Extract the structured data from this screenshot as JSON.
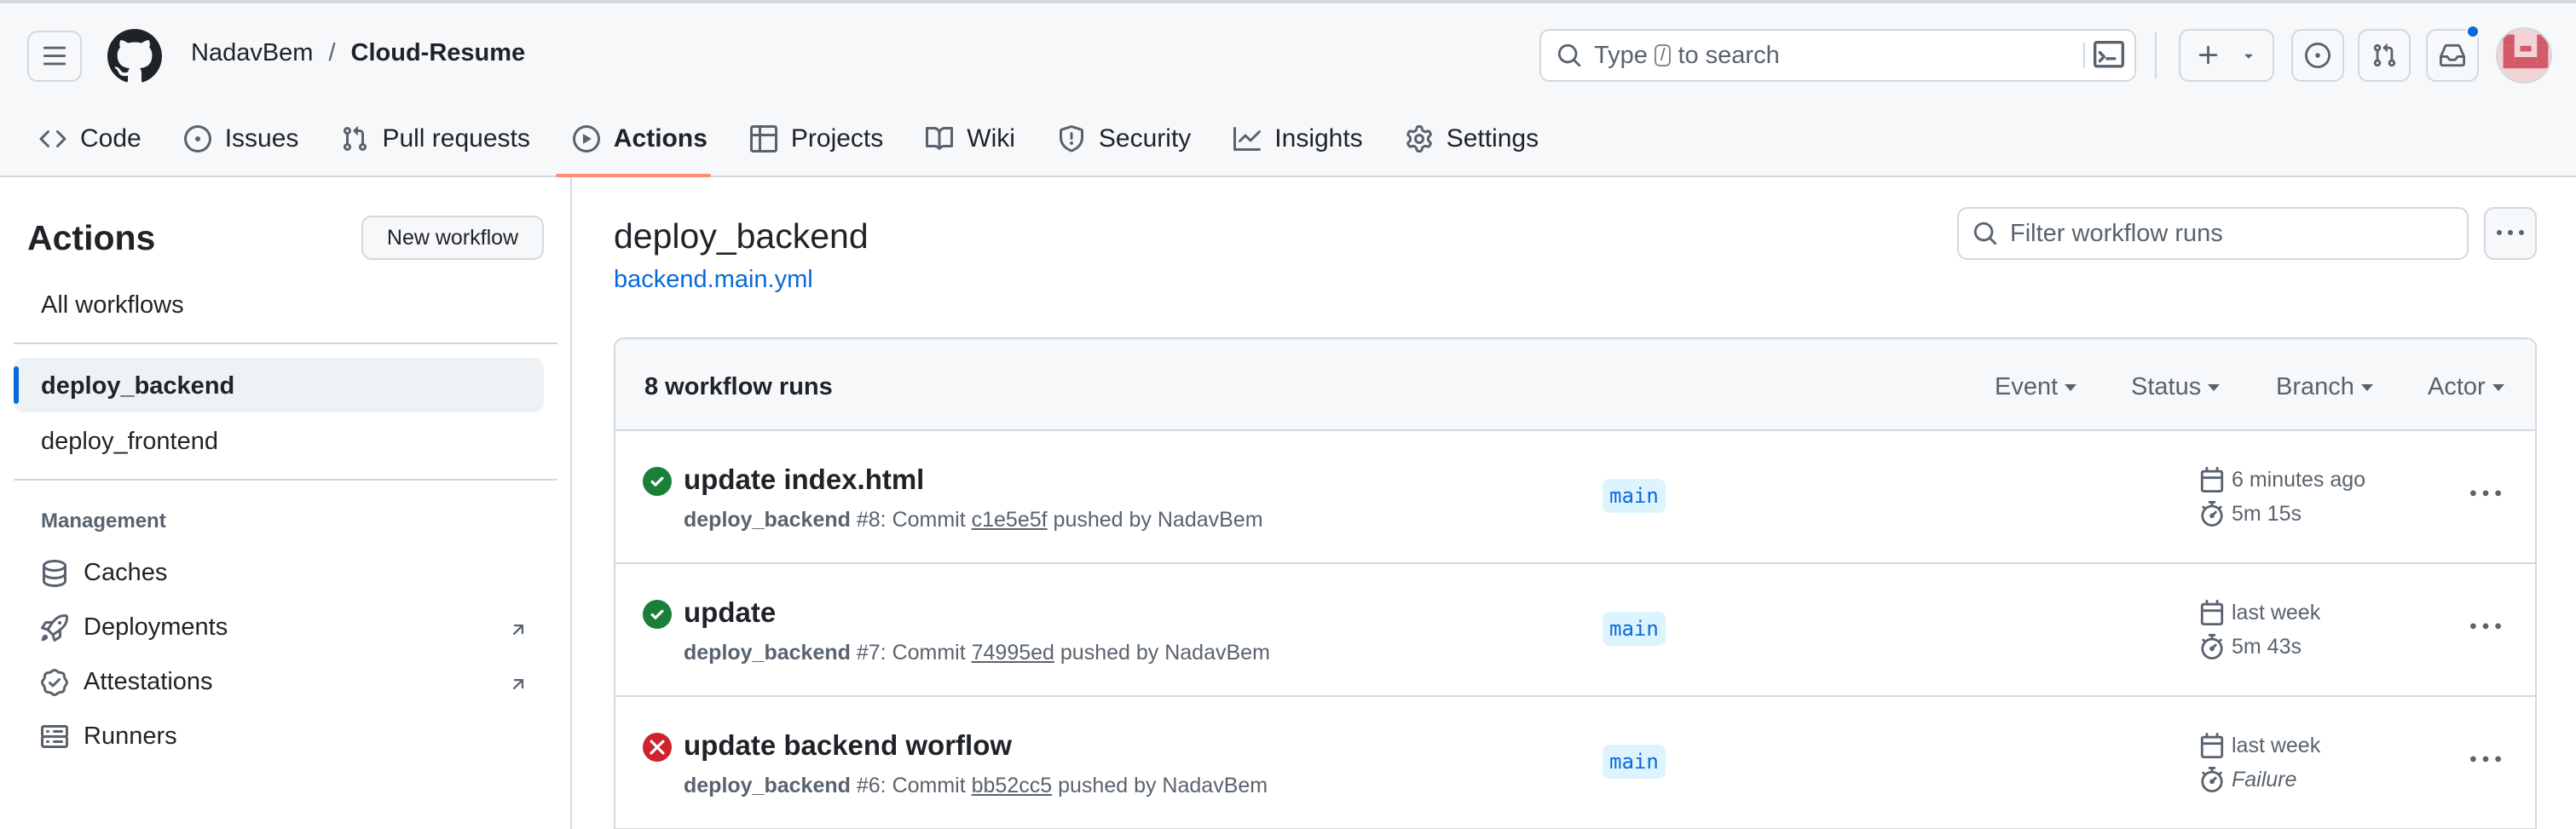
{
  "repo": {
    "owner": "NadavBem",
    "separator": "/",
    "name": "Cloud-Resume"
  },
  "search": {
    "prefix": "Type",
    "key": "/",
    "suffix": "to search"
  },
  "nav": {
    "tabs": [
      {
        "label": "Code",
        "icon": "code-icon"
      },
      {
        "label": "Issues",
        "icon": "issue-icon"
      },
      {
        "label": "Pull requests",
        "icon": "pull-request-icon"
      },
      {
        "label": "Actions",
        "icon": "play-icon",
        "active": true
      },
      {
        "label": "Projects",
        "icon": "table-icon"
      },
      {
        "label": "Wiki",
        "icon": "book-icon"
      },
      {
        "label": "Security",
        "icon": "shield-icon"
      },
      {
        "label": "Insights",
        "icon": "graph-icon"
      },
      {
        "label": "Settings",
        "icon": "gear-icon"
      }
    ]
  },
  "sidebar": {
    "title": "Actions",
    "new_workflow": "New workflow",
    "all_workflows": "All workflows",
    "workflows": [
      {
        "label": "deploy_backend",
        "selected": true
      },
      {
        "label": "deploy_frontend",
        "selected": false
      }
    ],
    "management": {
      "heading": "Management",
      "items": [
        {
          "label": "Caches",
          "icon": "database-icon"
        },
        {
          "label": "Deployments",
          "icon": "rocket-icon",
          "external": true
        },
        {
          "label": "Attestations",
          "icon": "verified-icon",
          "external": true
        },
        {
          "label": "Runners",
          "icon": "server-icon"
        }
      ]
    }
  },
  "main": {
    "workflow_title": "deploy_backend",
    "workflow_file": "backend.main.yml",
    "filter_placeholder": "Filter workflow runs",
    "runs_count": "8 workflow runs",
    "filters": [
      "Event",
      "Status",
      "Branch",
      "Actor"
    ],
    "runs": [
      {
        "title": "update index.html",
        "status": "success",
        "workflow": "deploy_backend",
        "number": "#8",
        "commit_label": ": Commit",
        "sha": "c1e5e5f",
        "pushed_by": "pushed by NadavBem",
        "branch": "main",
        "when": "6 minutes ago",
        "duration": "5m 15s"
      },
      {
        "title": "update",
        "status": "success",
        "workflow": "deploy_backend",
        "number": "#7",
        "commit_label": ": Commit",
        "sha": "74995ed",
        "pushed_by": "pushed by NadavBem",
        "branch": "main",
        "when": "last week",
        "duration": "5m 43s"
      },
      {
        "title": "update backend worflow",
        "status": "failure",
        "workflow": "deploy_backend",
        "number": "#6",
        "commit_label": ": Commit",
        "sha": "bb52cc5",
        "pushed_by": "pushed by NadavBem",
        "branch": "main",
        "when": "last week",
        "duration": "Failure"
      }
    ]
  },
  "colors": {
    "accent": "#0969da",
    "success": "#1a7f37",
    "danger": "#cf222e",
    "tab_underline": "#fd8c73"
  }
}
